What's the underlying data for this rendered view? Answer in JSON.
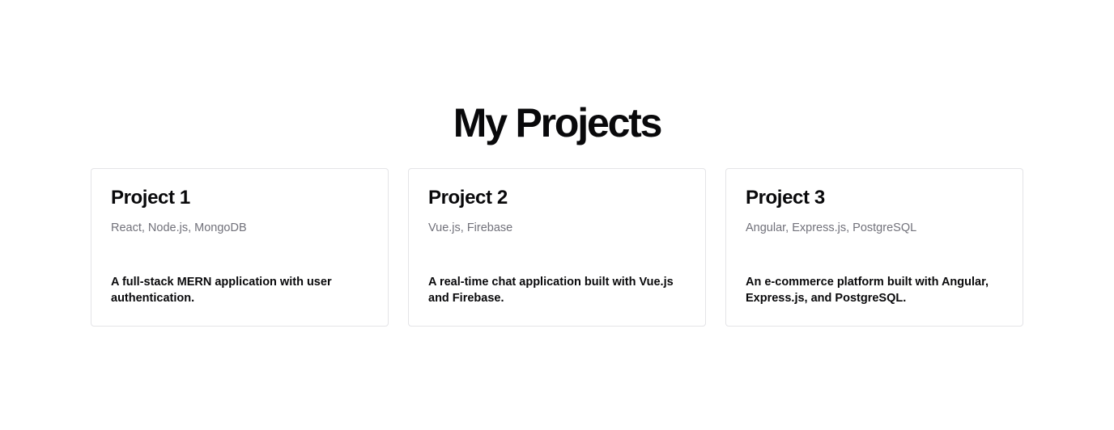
{
  "section": {
    "title": "My Projects"
  },
  "projects": [
    {
      "title": "Project 1",
      "tech": "React, Node.js, MongoDB",
      "description": "A full-stack MERN application with user authentication."
    },
    {
      "title": "Project 2",
      "tech": "Vue.js, Firebase",
      "description": "A real-time chat application built with Vue.js and Firebase."
    },
    {
      "title": "Project 3",
      "tech": "Angular, Express.js, PostgreSQL",
      "description": "An e-commerce platform built with Angular, Express.js, and PostgreSQL."
    }
  ]
}
